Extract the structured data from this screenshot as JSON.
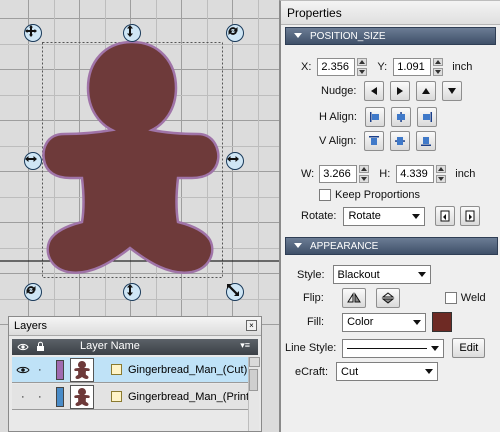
{
  "colors": {
    "shape_fill": "#6e3a3a",
    "shape_stroke": "#a074a8",
    "panel_header": "#4a5a72",
    "selected_row": "#bfe2f7"
  },
  "properties": {
    "title": "Properties",
    "position_size": {
      "header": "POSITION_SIZE",
      "x_label": "X:",
      "x_value": "2.356",
      "y_label": "Y:",
      "y_value": "1.091",
      "unit": "inch",
      "nudge_label": "Nudge:",
      "h_align_label": "H Align:",
      "v_align_label": "V Align:",
      "w_label": "W:",
      "w_value": "3.266",
      "h_label": "H:",
      "h_value": "4.339",
      "keep_proportions_label": "Keep Proportions",
      "keep_proportions_checked": false,
      "rotate_label": "Rotate:",
      "rotate_value": "Rotate"
    },
    "appearance": {
      "header": "APPEARANCE",
      "style_label": "Style:",
      "style_value": "Blackout",
      "flip_label": "Flip:",
      "weld_label": "Weld",
      "weld_checked": false,
      "fill_label": "Fill:",
      "fill_value": "Color",
      "fill_color": "#6e2a24",
      "line_style_label": "Line Style:",
      "edit_label": "Edit",
      "ecraft_label": "eCraft:",
      "ecraft_value": "Cut"
    }
  },
  "layers": {
    "title": "Layers",
    "column_header": "Layer Name",
    "rows": [
      {
        "name": "Gingerbread_Man_(Cut)",
        "color": "#a06ab0",
        "selected": true
      },
      {
        "name": "Gingerbread_Man_(Print)",
        "color": "#4a8cc8",
        "selected": false
      }
    ]
  }
}
